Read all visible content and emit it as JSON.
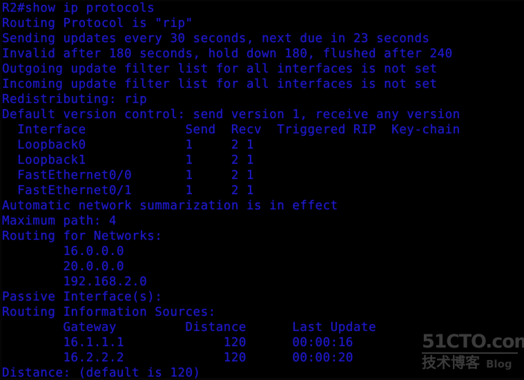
{
  "terminal": {
    "prompt_line": "R2#show ip protocols",
    "text_color": "#1d18c4",
    "background_color": "#000000",
    "lines": [
      "R2#show ip protocols",
      "Routing Protocol is \"rip\"",
      "Sending updates every 30 seconds, next due in 23 seconds",
      "Invalid after 180 seconds, hold down 180, flushed after 240",
      "Outgoing update filter list for all interfaces is not set",
      "Incoming update filter list for all interfaces is not set",
      "Redistributing: rip",
      "Default version control: send version 1, receive any version",
      "  Interface             Send  Recv  Triggered RIP  Key-chain",
      "  Loopback0             1     2 1",
      "  Loopback1             1     2 1",
      "  FastEthernet0/0       1     2 1",
      "  FastEthernet0/1       1     2 1",
      "Automatic network summarization is in effect",
      "Maximum path: 4",
      "Routing for Networks:",
      "        16.0.0.0",
      "        20.0.0.0",
      "        192.168.2.0",
      "Passive Interface(s):",
      "Routing Information Sources:",
      "        Gateway         Distance      Last Update",
      "        16.1.1.1             120      00:00:16",
      "        16.2.2.2             120      00:00:20",
      "Distance: (default is 120)"
    ],
    "command": {
      "device": "R2",
      "prompt_symbol": "#",
      "name": "show ip protocols"
    },
    "protocol_summary": {
      "protocol": "rip",
      "update_interval_seconds": "30",
      "next_due_seconds": "23",
      "invalid_after_seconds": "180",
      "hold_down_seconds": "180",
      "flushed_after_seconds": "240",
      "outgoing_filter": "not set",
      "incoming_filter": "not set",
      "redistributing": "rip",
      "send_version": "1",
      "receive_version": "any version",
      "automatic_summarization": "in effect",
      "maximum_path": "4",
      "distance_default": "120"
    },
    "interface_table": {
      "headers": [
        "Interface",
        "Send",
        "Recv",
        "Triggered RIP",
        "Key-chain"
      ],
      "rows": [
        {
          "interface": "Loopback0",
          "send": "1",
          "recv": "2 1",
          "triggered_rip": "",
          "key_chain": ""
        },
        {
          "interface": "Loopback1",
          "send": "1",
          "recv": "2 1",
          "triggered_rip": "",
          "key_chain": ""
        },
        {
          "interface": "FastEthernet0/0",
          "send": "1",
          "recv": "2 1",
          "triggered_rip": "",
          "key_chain": ""
        },
        {
          "interface": "FastEthernet0/1",
          "send": "1",
          "recv": "2 1",
          "triggered_rip": "",
          "key_chain": ""
        }
      ]
    },
    "routing_for_networks": {
      "label": "Routing for Networks:",
      "networks": [
        "16.0.0.0",
        "20.0.0.0",
        "192.168.2.0"
      ]
    },
    "passive_interfaces": {
      "label": "Passive Interface(s):",
      "entries": []
    },
    "routing_information_sources": {
      "label": "Routing Information Sources:",
      "headers": [
        "Gateway",
        "Distance",
        "Last Update"
      ],
      "rows": [
        {
          "gateway": "16.1.1.1",
          "distance": "120",
          "last_update": "00:00:16"
        },
        {
          "gateway": "16.2.2.2",
          "distance": "120",
          "last_update": "00:00:20"
        }
      ]
    },
    "footer_line": "Distance: (default is 120)"
  },
  "watermark": {
    "main": "51CTO.com",
    "chinese": "技术博客",
    "blog": "Blog"
  }
}
